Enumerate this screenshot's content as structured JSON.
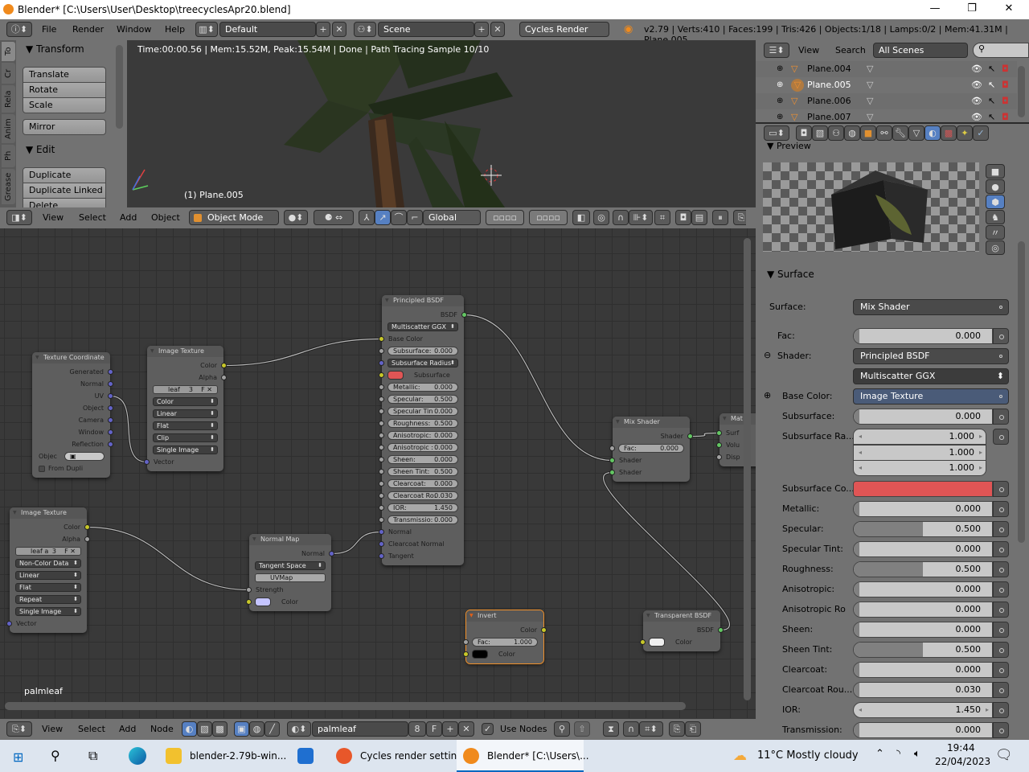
{
  "window": {
    "title": "Blender* [C:\\Users\\User\\Desktop\\treecyclesApr20.blend]",
    "controls": [
      "—",
      "❐",
      "✕"
    ]
  },
  "info_header": {
    "menus": [
      "File",
      "Render",
      "Window",
      "Help"
    ],
    "layout": "Default",
    "scene": "Scene",
    "engine": "Cycles Render",
    "stats": "v2.79 | Verts:410 | Faces:199 | Tris:426 | Objects:1/18 | Lamps:0/2 | Mem:41.31M | Plane.005"
  },
  "tool_shelf": {
    "tabs": [
      "To",
      "Cr",
      "Rela",
      "Anim",
      "Ph",
      "Grease"
    ],
    "transform": {
      "title": "Transform",
      "buttons": [
        "Translate",
        "Rotate",
        "Scale"
      ],
      "mirror": "Mirror"
    },
    "edit": {
      "title": "Edit",
      "buttons": [
        "Duplicate",
        "Duplicate Linked",
        "Delete"
      ]
    }
  },
  "viewport": {
    "render_status": "Time:00:00.56 | Mem:15.52M, Peak:15.54M | Done | Path Tracing Sample 10/10",
    "object_label": "(1) Plane.005"
  },
  "view3d_header": {
    "menus": [
      "View",
      "Select",
      "Add",
      "Object"
    ],
    "mode": "Object Mode",
    "orientation": "Global"
  },
  "outliner": {
    "menus": [
      "View",
      "Search"
    ],
    "filter": "All Scenes",
    "items": [
      {
        "name": "Plane.004",
        "selected": false
      },
      {
        "name": "Plane.005",
        "selected": true
      },
      {
        "name": "Plane.006",
        "selected": false
      },
      {
        "name": "Plane.007",
        "selected": false
      }
    ]
  },
  "properties": {
    "active_tab": "material",
    "preview": {
      "title": "Preview"
    },
    "surface": {
      "title": "Surface",
      "rows": [
        {
          "label": "Surface:",
          "type": "select",
          "value": "Mix Shader"
        },
        {
          "label": "Fac:",
          "type": "slider",
          "value": "0.000",
          "fill": 0
        },
        {
          "label": "Shader:",
          "type": "select",
          "value": "Principled BSDF",
          "expander": "minus"
        },
        {
          "label": "",
          "type": "dropdown",
          "value": "Multiscatter GGX"
        },
        {
          "label": "Base Color:",
          "type": "link",
          "value": "Image Texture",
          "expander": "plus"
        },
        {
          "label": "Subsurface:",
          "type": "slider",
          "value": "0.000",
          "fill": 0
        },
        {
          "label": "Subsurface Ra...",
          "type": "vector",
          "values": [
            "1.000",
            "1.000",
            "1.000"
          ]
        },
        {
          "label": "Subsurface Co...",
          "type": "color",
          "color": "#e05555"
        },
        {
          "label": "Metallic:",
          "type": "slider",
          "value": "0.000",
          "fill": 0
        },
        {
          "label": "Specular:",
          "type": "slider",
          "value": "0.500",
          "fill": 0.5
        },
        {
          "label": "Specular Tint:",
          "type": "slider",
          "value": "0.000",
          "fill": 0
        },
        {
          "label": "Roughness:",
          "type": "slider",
          "value": "0.500",
          "fill": 0.5
        },
        {
          "label": "Anisotropic:",
          "type": "slider",
          "value": "0.000",
          "fill": 0
        },
        {
          "label": "Anisotropic Ro",
          "type": "slider",
          "value": "0.000",
          "fill": 0
        },
        {
          "label": "Sheen:",
          "type": "slider",
          "value": "0.000",
          "fill": 0
        },
        {
          "label": "Sheen Tint:",
          "type": "slider",
          "value": "0.500",
          "fill": 0.5
        },
        {
          "label": "Clearcoat:",
          "type": "slider",
          "value": "0.000",
          "fill": 0
        },
        {
          "label": "Clearcoat Rou...",
          "type": "slider",
          "value": "0.030",
          "fill": 0.03
        },
        {
          "label": "IOR:",
          "type": "number",
          "value": "1.450"
        },
        {
          "label": "Transmission:",
          "type": "slider",
          "value": "0.000",
          "fill": 0
        }
      ]
    }
  },
  "node_editor": {
    "material_label": "palmleaf",
    "nodes": [
      {
        "id": "texcoord",
        "title": "Texture Coordinate",
        "rows": [
          {
            "t": "out",
            "label": "Generated",
            "sock": "blue"
          },
          {
            "t": "out",
            "label": "Normal",
            "sock": "blue"
          },
          {
            "t": "out",
            "label": "UV",
            "sock": "blue"
          },
          {
            "t": "out",
            "label": "Object",
            "sock": "blue"
          },
          {
            "t": "out",
            "label": "Camera",
            "sock": "blue"
          },
          {
            "t": "out",
            "label": "Window",
            "sock": "blue"
          },
          {
            "t": "out",
            "label": "Reflection",
            "sock": "blue"
          },
          {
            "t": "obj",
            "label": "Objec"
          },
          {
            "t": "check",
            "label": "From Dupli"
          }
        ]
      },
      {
        "id": "imgtex1",
        "title": "Image Texture",
        "rows": [
          {
            "t": "out",
            "label": "Color",
            "sock": "yellow"
          },
          {
            "t": "out",
            "label": "Alpha",
            "sock": "gray"
          },
          {
            "t": "image",
            "label": "leaf",
            "users": "3"
          },
          {
            "t": "select",
            "label": "Color"
          },
          {
            "t": "select",
            "label": "Linear"
          },
          {
            "t": "select",
            "label": "Flat"
          },
          {
            "t": "select",
            "label": "Clip"
          },
          {
            "t": "select",
            "label": "Single Image"
          },
          {
            "t": "in",
            "label": "Vector",
            "sock": "blue"
          }
        ]
      },
      {
        "id": "imgtex2",
        "title": "Image Texture",
        "rows": [
          {
            "t": "out",
            "label": "Color",
            "sock": "yellow"
          },
          {
            "t": "out",
            "label": "Alpha",
            "sock": "gray"
          },
          {
            "t": "image",
            "label": "leaf a",
            "users": "3"
          },
          {
            "t": "select",
            "label": "Non-Color Data"
          },
          {
            "t": "select",
            "label": "Linear"
          },
          {
            "t": "select",
            "label": "Flat"
          },
          {
            "t": "select",
            "label": "Repeat"
          },
          {
            "t": "select",
            "label": "Single Image"
          },
          {
            "t": "in",
            "label": "Vector",
            "sock": "blue"
          }
        ]
      },
      {
        "id": "normalmap",
        "title": "Normal Map",
        "rows": [
          {
            "t": "out",
            "label": "Normal",
            "sock": "blue"
          },
          {
            "t": "select",
            "label": "Tangent Space"
          },
          {
            "t": "uv",
            "label": "UVMap"
          },
          {
            "t": "in",
            "label": "Strength",
            "sock": "gray"
          },
          {
            "t": "color",
            "label": "Color",
            "swatch": "#c4c4ff",
            "sock": "yellow"
          }
        ]
      },
      {
        "id": "principled",
        "title": "Principled BSDF",
        "rows": [
          {
            "t": "out",
            "label": "BSDF",
            "sock": "green"
          },
          {
            "t": "select",
            "label": "Multiscatter GGX"
          },
          {
            "t": "in",
            "label": "Base Color",
            "sock": "yellow"
          },
          {
            "t": "field",
            "label": "Subsurface:",
            "value": "0.000",
            "sock": "gray"
          },
          {
            "t": "select",
            "label": "Subsurface Radius",
            "sock": "blue"
          },
          {
            "t": "color",
            "label": "Subsurface Co",
            "swatch": "#e05555",
            "sock": "yellow"
          },
          {
            "t": "field",
            "label": "Metallic:",
            "value": "0.000",
            "sock": "gray"
          },
          {
            "t": "field",
            "label": "Specular:",
            "value": "0.500",
            "sock": "gray"
          },
          {
            "t": "field",
            "label": "Specular Tin",
            "value": "0.000",
            "sock": "gray"
          },
          {
            "t": "field",
            "label": "Roughness:",
            "value": "0.500",
            "sock": "gray"
          },
          {
            "t": "field",
            "label": "Anisotropic:",
            "value": "0.000",
            "sock": "gray"
          },
          {
            "t": "field",
            "label": "Anisotropic :",
            "value": "0.000",
            "sock": "gray"
          },
          {
            "t": "field",
            "label": "Sheen:",
            "value": "0.000",
            "sock": "gray"
          },
          {
            "t": "field",
            "label": "Sheen Tint:",
            "value": "0.500",
            "sock": "gray"
          },
          {
            "t": "field",
            "label": "Clearcoat:",
            "value": "0.000",
            "sock": "gray"
          },
          {
            "t": "field",
            "label": "Clearcoat Ro:",
            "value": "0.030",
            "sock": "gray"
          },
          {
            "t": "field",
            "label": "IOR:",
            "value": "1.450",
            "sock": "gray"
          },
          {
            "t": "field",
            "label": "Transmissio:",
            "value": "0.000",
            "sock": "gray"
          },
          {
            "t": "in",
            "label": "Normal",
            "sock": "blue"
          },
          {
            "t": "in",
            "label": "Clearcoat Normal",
            "sock": "blue"
          },
          {
            "t": "in",
            "label": "Tangent",
            "sock": "blue"
          }
        ]
      },
      {
        "id": "mix",
        "title": "Mix Shader",
        "rows": [
          {
            "t": "out",
            "label": "Shader",
            "sock": "green"
          },
          {
            "t": "field",
            "label": "Fac:",
            "value": "0.000",
            "sock": "gray"
          },
          {
            "t": "in",
            "label": "Shader",
            "sock": "green"
          },
          {
            "t": "in",
            "label": "Shader",
            "sock": "green"
          }
        ]
      },
      {
        "id": "output",
        "title": "Mat",
        "rows": [
          {
            "t": "in",
            "label": "Surf",
            "sock": "green"
          },
          {
            "t": "in",
            "label": "Volu",
            "sock": "green"
          },
          {
            "t": "in",
            "label": "Disp",
            "sock": "gray"
          }
        ]
      },
      {
        "id": "invert",
        "title": "Invert",
        "selected": true,
        "rows": [
          {
            "t": "out",
            "label": "Color",
            "sock": "yellow"
          },
          {
            "t": "field",
            "label": "Fac:",
            "value": "1.000",
            "sock": "gray"
          },
          {
            "t": "color",
            "label": "Color",
            "swatch": "#000000",
            "sock": "yellow"
          }
        ]
      },
      {
        "id": "transparent",
        "title": "Transparent BSDF",
        "rows": [
          {
            "t": "out",
            "label": "BSDF",
            "sock": "green"
          },
          {
            "t": "color",
            "label": "Color",
            "swatch": "#eeeeee",
            "sock": "yellow"
          }
        ]
      }
    ],
    "links": [
      [
        "texcoord",
        2,
        "imgtex1",
        8
      ],
      [
        "imgtex1",
        0,
        "principled",
        2
      ],
      [
        "imgtex2",
        0,
        "normalmap",
        3
      ],
      [
        "normalmap",
        0,
        "principled",
        18
      ],
      [
        "principled",
        0,
        "mix",
        2
      ],
      [
        "transparent",
        0,
        "mix",
        3
      ],
      [
        "mix",
        0,
        "output",
        0
      ]
    ]
  },
  "node_header": {
    "menus": [
      "View",
      "Select",
      "Add",
      "Node"
    ],
    "material": "palmleaf",
    "users": "8",
    "fake": "F",
    "use_nodes_label": "Use Nodes",
    "use_nodes": true
  },
  "taskbar": {
    "apps": [
      {
        "label": "blender-2.79b-win...",
        "icon": "folder-icon",
        "color": "#f2c12e"
      },
      {
        "label": "",
        "icon": "mail-icon",
        "color": "#1f6fd0"
      },
      {
        "label": "Cycles render settin...",
        "icon": "firefox-icon",
        "color": "#e8572a"
      },
      {
        "label": "Blender* [C:\\Users\\...",
        "icon": "blender-icon",
        "color": "#f08a1c",
        "active": true
      }
    ],
    "weather": "11°C  Mostly cloudy",
    "time": "19:44",
    "date": "22/04/2023"
  },
  "colors": {
    "accent": "#5680c2",
    "socket_yellow": "#c7c729",
    "socket_gray": "#a1a1a1",
    "socket_blue": "#6363c7",
    "socket_green": "#63c763",
    "selected_node": "#f0902a"
  }
}
